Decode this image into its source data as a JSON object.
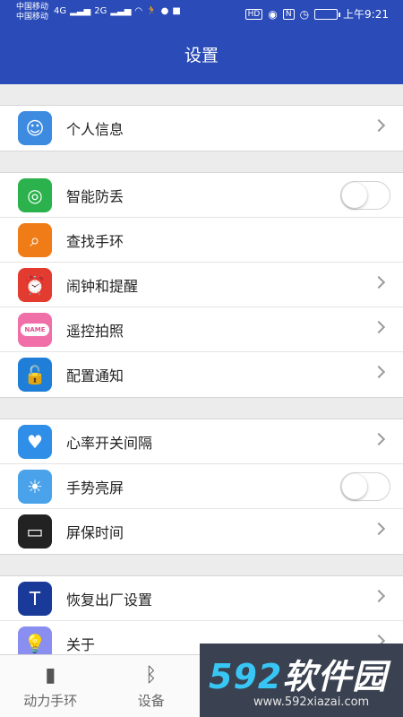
{
  "status_bar": {
    "carrier1": "中国移动",
    "carrier2": "中国移动",
    "net1": "4G",
    "net2": "2G",
    "right_hd": "HD",
    "right_n": "N",
    "time": "上午9:21"
  },
  "header": {
    "title": "设置"
  },
  "groups": [
    {
      "items": [
        {
          "label": "个人信息",
          "icon": "avatar-face-icon",
          "color": "#3d8be0",
          "control": "chevron"
        }
      ]
    },
    {
      "items": [
        {
          "label": "智能防丢",
          "icon": "radar-icon",
          "color": "#2bb24c",
          "control": "toggle",
          "on": false
        },
        {
          "label": "查找手环",
          "icon": "magnifier-icon",
          "color": "#f07c18",
          "control": "none"
        },
        {
          "label": "闹钟和提醒",
          "icon": "alarm-clock-icon",
          "color": "#e33b2f",
          "control": "chevron"
        },
        {
          "label": "遥控拍照",
          "icon": "name-tag-icon",
          "color": "#f06fa9",
          "control": "chevron",
          "badge": "NAME"
        },
        {
          "label": "配置通知",
          "icon": "unlock-icon",
          "color": "#1e7ed8",
          "control": "chevron"
        }
      ]
    },
    {
      "items": [
        {
          "label": "心率开关间隔",
          "icon": "heart-pulse-icon",
          "color": "#2f8ee8",
          "control": "chevron"
        },
        {
          "label": "手势亮屏",
          "icon": "sun-icon",
          "color": "#4aa3ea",
          "control": "toggle",
          "on": false
        },
        {
          "label": "屏保时间",
          "icon": "monitor-book-icon",
          "color": "#222222",
          "control": "chevron"
        }
      ]
    },
    {
      "items": [
        {
          "label": "恢复出厂设置",
          "icon": "hammer-icon",
          "color": "#1a3a9a",
          "control": "chevron"
        },
        {
          "label": "关于",
          "icon": "lightbulb-icon",
          "color": "#8a8ef0",
          "control": "chevron"
        }
      ]
    }
  ],
  "tabs": [
    {
      "label": "动力手环",
      "icon": "band-icon"
    },
    {
      "label": "设备",
      "icon": "bluetooth-icon"
    },
    {
      "label": "",
      "icon": "settings-icon"
    },
    {
      "label": "",
      "icon": "user-icon"
    }
  ],
  "watermark": {
    "brand_num": "592",
    "brand_text": "软件园",
    "url": "www.592xiazai.com"
  }
}
